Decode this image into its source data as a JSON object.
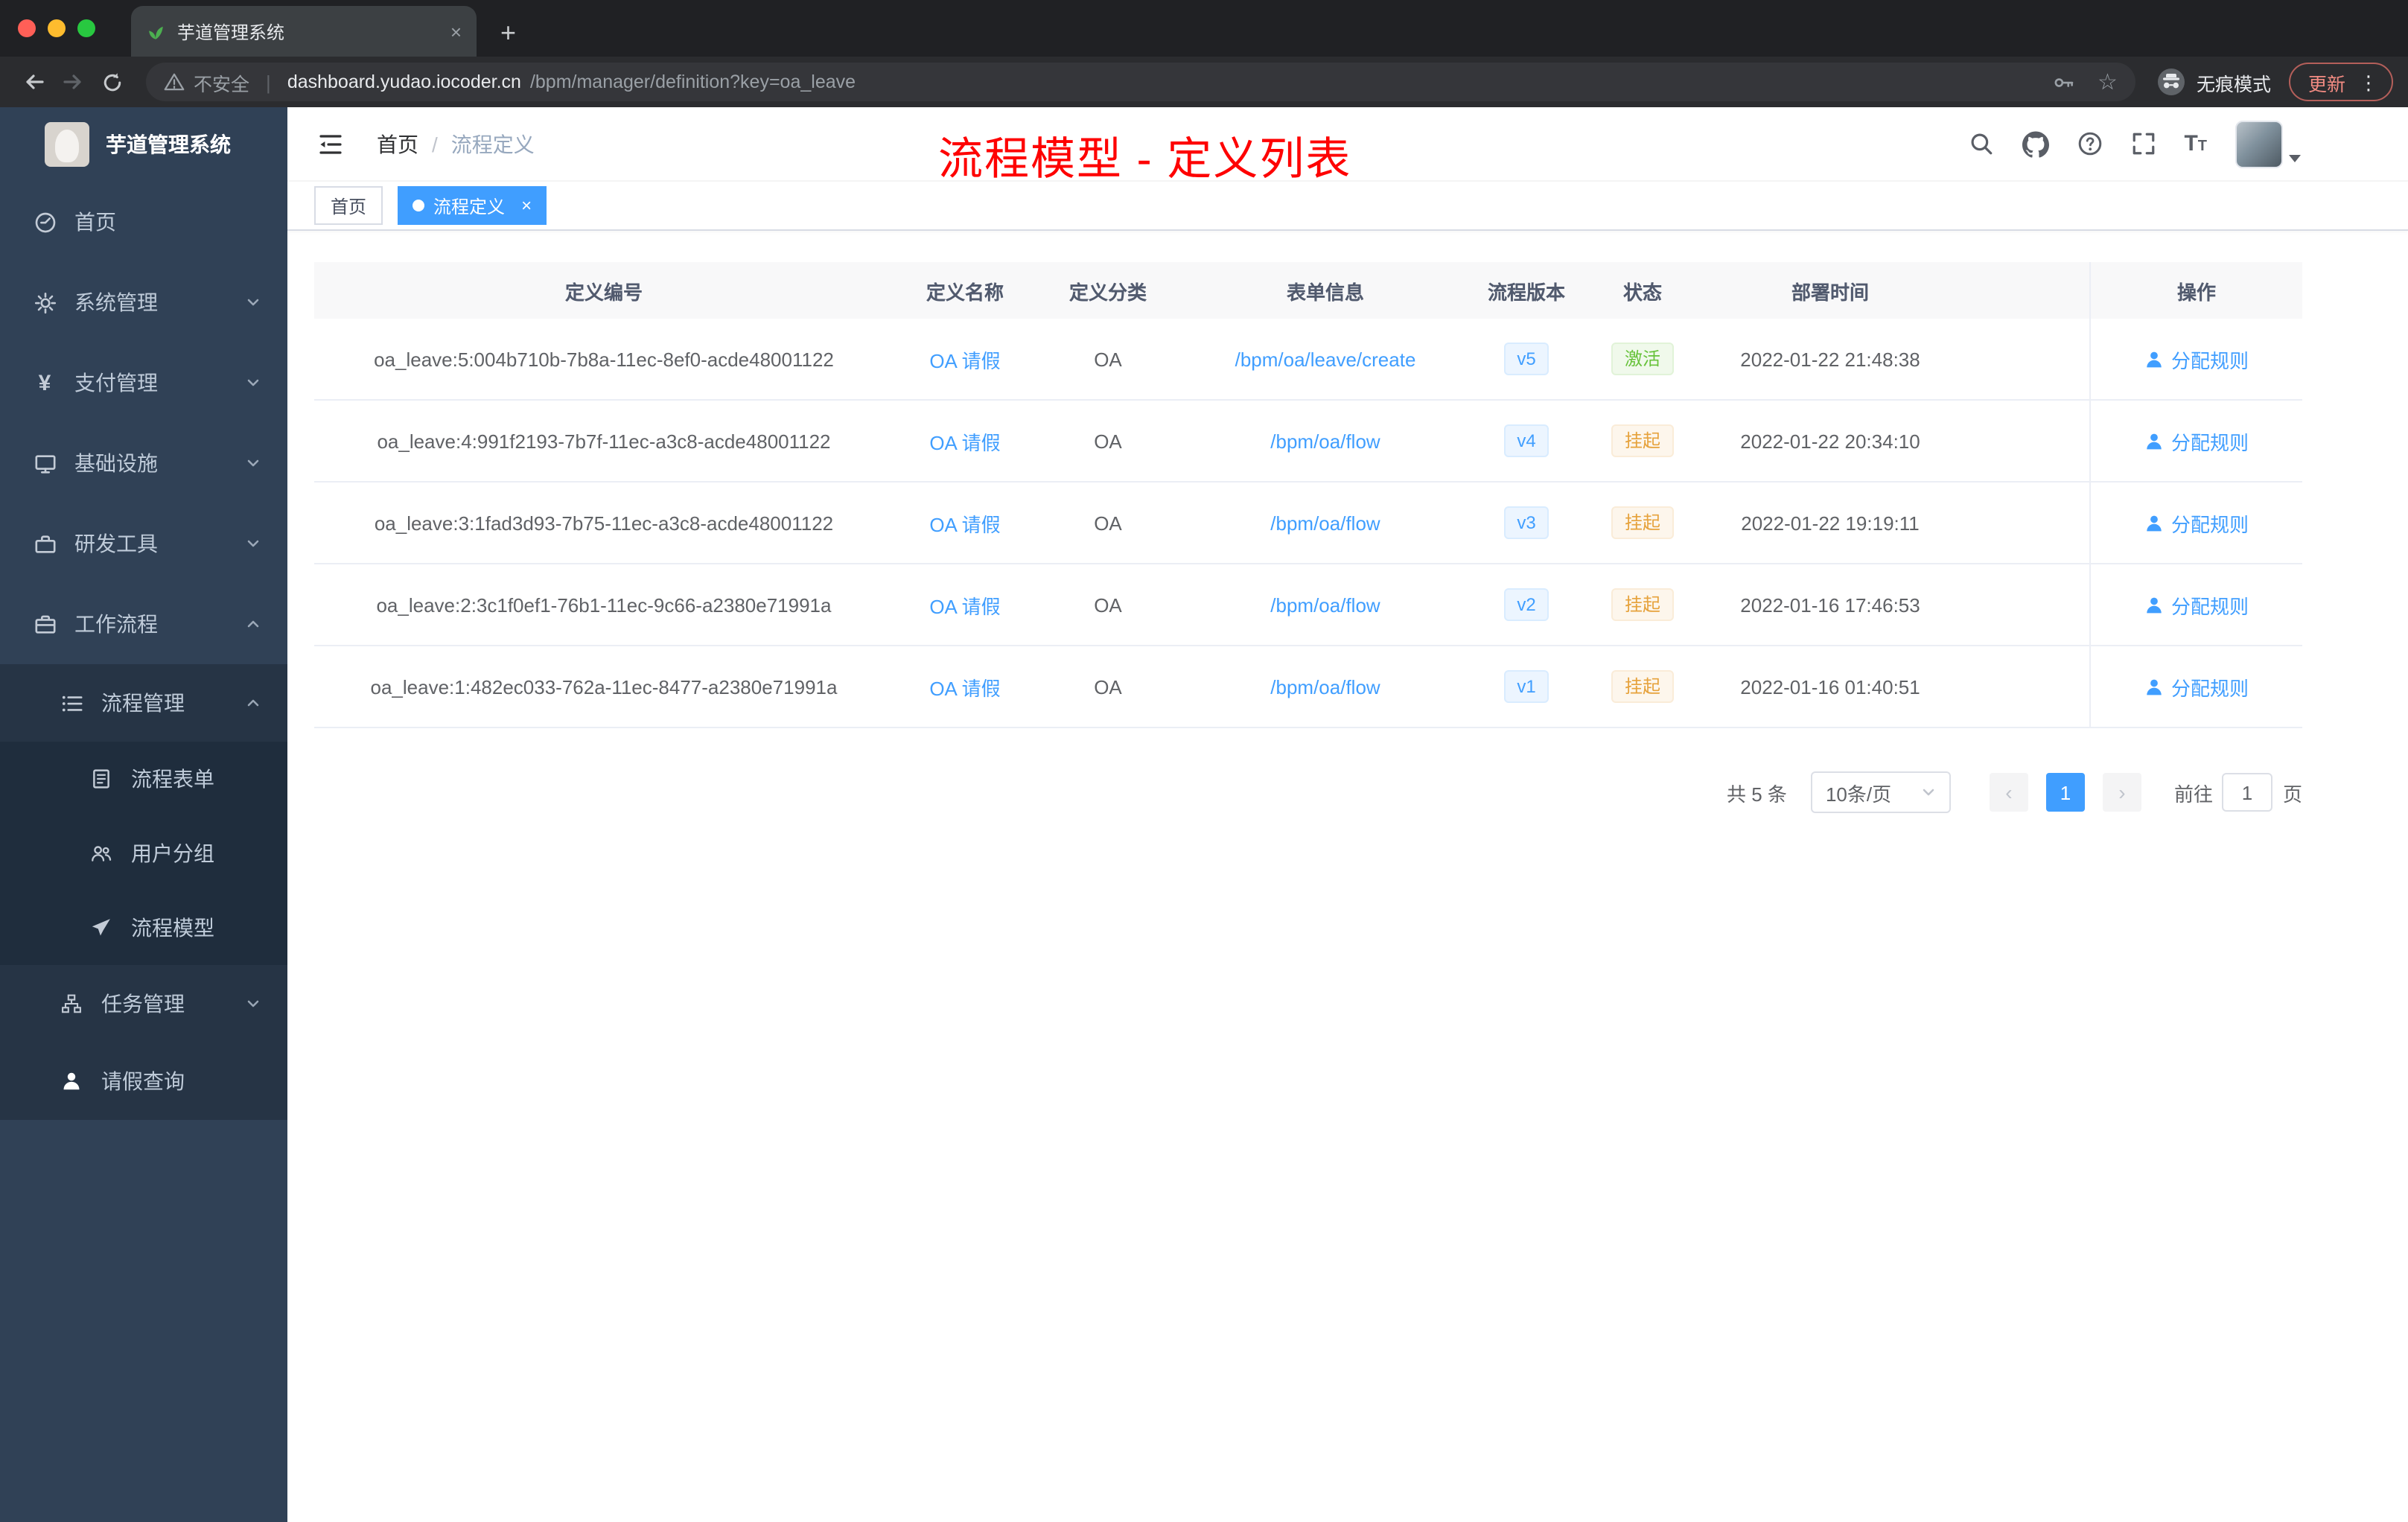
{
  "colors": {
    "accent": "#409eff",
    "success": "#67c23a",
    "warning": "#e6a23c",
    "annotation_red": "#fe0000",
    "sidebar_bg": "#304156"
  },
  "browser": {
    "tab_title": "芋道管理系统",
    "security_label": "不安全",
    "url_host": "dashboard.yudao.iocoder.cn",
    "url_path": "/bpm/manager/definition?key=oa_leave",
    "incognito_label": "无痕模式",
    "update_label": "更新"
  },
  "sidebar": {
    "logo_title": "芋道管理系统",
    "items": [
      {
        "label": "首页"
      },
      {
        "label": "系统管理"
      },
      {
        "label": "支付管理"
      },
      {
        "label": "基础设施"
      },
      {
        "label": "研发工具"
      },
      {
        "label": "工作流程"
      }
    ],
    "workflow_submenu": {
      "process_mgmt": "流程管理",
      "process_children": [
        "流程表单",
        "用户分组",
        "流程模型"
      ],
      "task_mgmt": "任务管理",
      "leave_query": "请假查询"
    }
  },
  "header": {
    "breadcrumb": [
      "首页",
      "流程定义"
    ],
    "separator": "/"
  },
  "annotation": "流程模型 - 定义列表",
  "tags": {
    "home": "首页",
    "active": "流程定义"
  },
  "table": {
    "headers": [
      "定义编号",
      "定义名称",
      "定义分类",
      "表单信息",
      "流程版本",
      "状态",
      "部署时间",
      "操作"
    ],
    "rows": [
      {
        "id": "oa_leave:5:004b710b-7b8a-11ec-8ef0-acde48001122",
        "name": "OA 请假",
        "category": "OA",
        "form": "/bpm/oa/leave/create",
        "version": "v5",
        "status": "激活",
        "status_type": "success",
        "time": "2022-01-22 21:48:38",
        "action": "分配规则"
      },
      {
        "id": "oa_leave:4:991f2193-7b7f-11ec-a3c8-acde48001122",
        "name": "OA 请假",
        "category": "OA",
        "form": "/bpm/oa/flow",
        "version": "v4",
        "status": "挂起",
        "status_type": "warning",
        "time": "2022-01-22 20:34:10",
        "action": "分配规则"
      },
      {
        "id": "oa_leave:3:1fad3d93-7b75-11ec-a3c8-acde48001122",
        "name": "OA 请假",
        "category": "OA",
        "form": "/bpm/oa/flow",
        "version": "v3",
        "status": "挂起",
        "status_type": "warning",
        "time": "2022-01-22 19:19:11",
        "action": "分配规则"
      },
      {
        "id": "oa_leave:2:3c1f0ef1-76b1-11ec-9c66-a2380e71991a",
        "name": "OA 请假",
        "category": "OA",
        "form": "/bpm/oa/flow",
        "version": "v2",
        "status": "挂起",
        "status_type": "warning",
        "time": "2022-01-16 17:46:53",
        "action": "分配规则"
      },
      {
        "id": "oa_leave:1:482ec033-762a-11ec-8477-a2380e71991a",
        "name": "OA 请假",
        "category": "OA",
        "form": "/bpm/oa/flow",
        "version": "v1",
        "status": "挂起",
        "status_type": "warning",
        "time": "2022-01-16 01:40:51",
        "action": "分配规则"
      }
    ]
  },
  "pagination": {
    "total": "共 5 条",
    "page_size": "10条/页",
    "current_page": "1",
    "goto_label": "前往",
    "goto_value": "1",
    "page_unit": "页"
  }
}
